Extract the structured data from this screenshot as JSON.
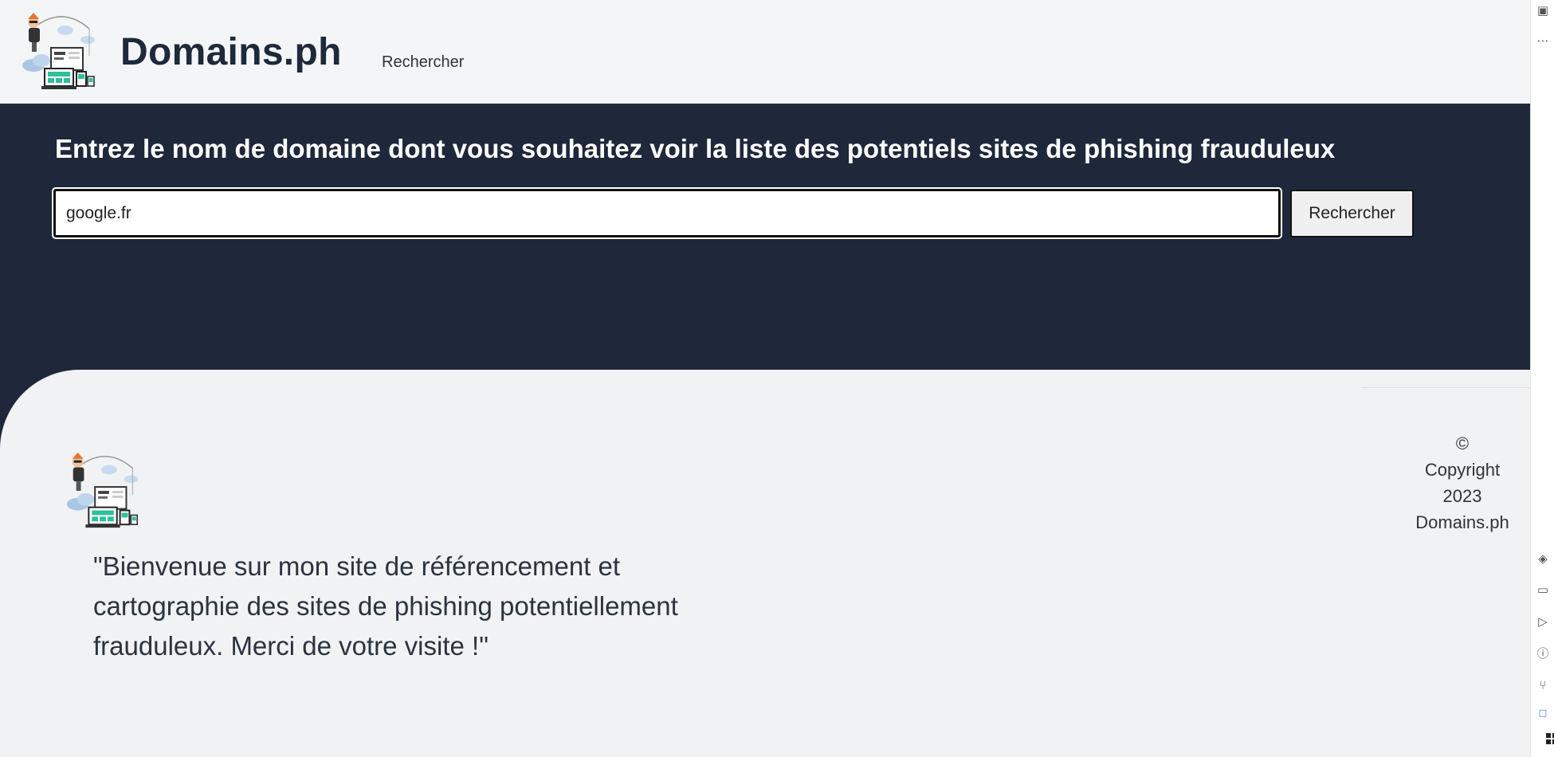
{
  "header": {
    "site_title": "Domains.ph",
    "nav_link": "Rechercher"
  },
  "hero": {
    "title": "Entrez le nom de domaine dont vous souhaitez voir la liste des potentiels sites de phishing frauduleux",
    "search_value": "google.fr",
    "search_button": "Rechercher"
  },
  "footer": {
    "quote": "\"Bienvenue sur mon site de référencement et cartographie des sites de phishing potentiellement frauduleux. Merci de votre visite !\"",
    "copyright": {
      "line1": "©",
      "line2": "Copyright",
      "line3": "2023",
      "line4": "Domains.ph"
    }
  },
  "icons": {
    "logo": "phishing-fisherman-logo",
    "strip": [
      "layout-icon",
      "more-icon",
      "debug-icon",
      "terminal-icon",
      "run-icon",
      "problems-icon",
      "git-branch-icon",
      "remote-icon",
      "windows-icon"
    ]
  },
  "colors": {
    "hero_bg": "#1f283b",
    "header_bg": "#f4f5f7",
    "footer_bg": "#f1f2f4",
    "title_text": "#1e293b"
  }
}
